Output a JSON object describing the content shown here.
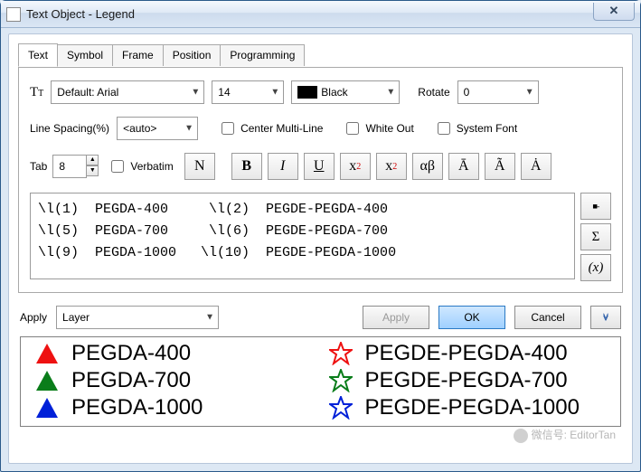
{
  "window": {
    "title": "Text Object - Legend"
  },
  "tabs": [
    {
      "label": "Text"
    },
    {
      "label": "Symbol"
    },
    {
      "label": "Frame"
    },
    {
      "label": "Position"
    },
    {
      "label": "Programming"
    }
  ],
  "font": {
    "family": "Default: Arial",
    "size": "14",
    "color_label": "Black",
    "rotate_label": "Rotate",
    "rotate_value": "0"
  },
  "line": {
    "spacing_label": "Line Spacing(%)",
    "spacing_value": "<auto>",
    "center_label": "Center Multi-Line",
    "whiteout_label": "White Out",
    "sysfont_label": "System Font"
  },
  "tabrow": {
    "tab_label": "Tab",
    "tab_value": "8",
    "verbatim_label": "Verbatim"
  },
  "textarea": "\\l(1)  PEGDA-400     \\l(2)  PEGDE-PEGDA-400\n\\l(5)  PEGDA-700     \\l(6)  PEGDE-PEGDA-700\n\\l(9)  PEGDA-1000   \\l(10)  PEGDE-PEGDA-1000",
  "apply": {
    "label": "Apply",
    "scope": "Layer",
    "btn_apply": "Apply",
    "btn_ok": "OK",
    "btn_cancel": "Cancel"
  },
  "legend": [
    {
      "symbol": "triangle-filled",
      "color": "#e11",
      "text": "PEGDA-400"
    },
    {
      "symbol": "star-outline",
      "color": "#e11",
      "text": "PEGDE-PEGDA-400"
    },
    {
      "symbol": "triangle-filled",
      "color": "#0a7d1a",
      "text": "PEGDA-700"
    },
    {
      "symbol": "star-outline",
      "color": "#0a7d1a",
      "text": "PEGDE-PEGDA-700"
    },
    {
      "symbol": "triangle-filled",
      "color": "#0020d8",
      "text": "PEGDA-1000"
    },
    {
      "symbol": "star-outline",
      "color": "#0020d8",
      "text": "PEGDE-PEGDA-1000"
    }
  ],
  "toolbar_labels": {
    "normal": "N",
    "bold": "B",
    "italic": "I",
    "underline": "U",
    "greek": "αβ",
    "upper_bar": "Ā",
    "tilde": "Ã",
    "dot": "Ȧ",
    "sigma": "Σ"
  },
  "watermark": "微信号: EditorTan"
}
